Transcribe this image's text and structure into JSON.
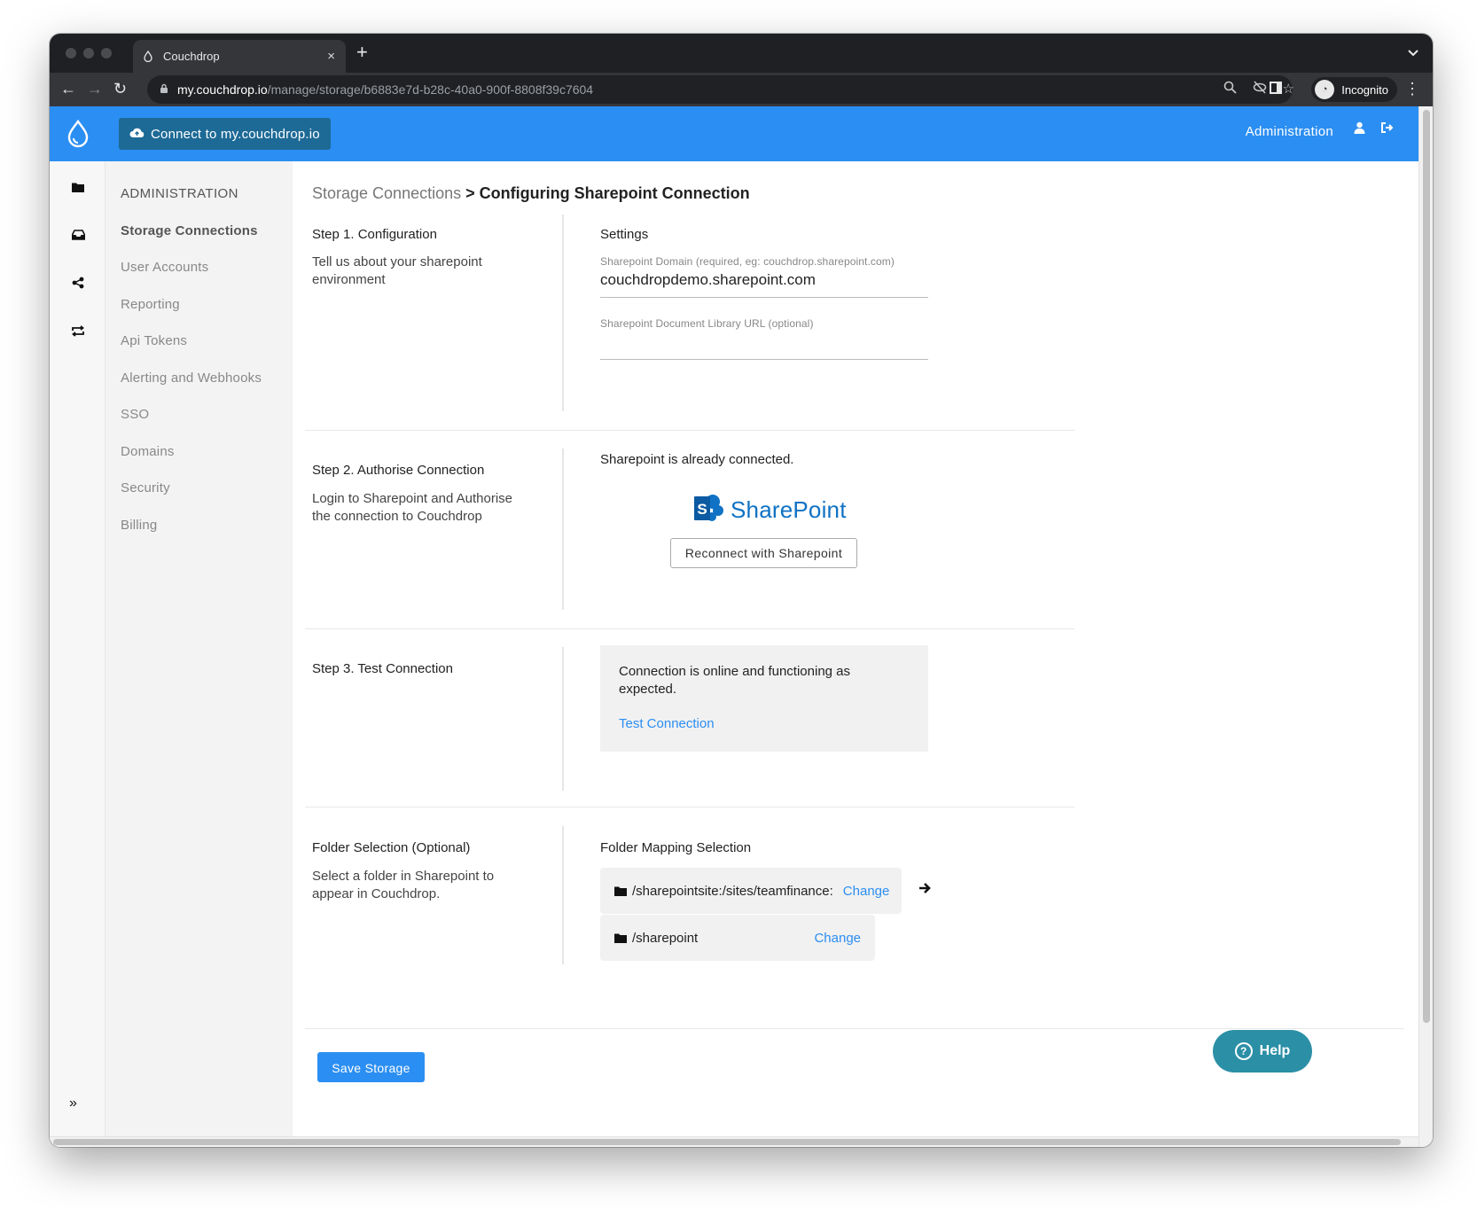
{
  "browser": {
    "tab_title": "Couchdrop",
    "tab_close": "×",
    "new_tab": "+",
    "url_host": "my.couchdrop.io",
    "url_path": "/manage/storage/b6883e7d-b28c-40a0-900f-8808f39c7604",
    "profile_label": "Incognito"
  },
  "header": {
    "connect_button": "Connect to my.couchdrop.io",
    "administration_link": "Administration"
  },
  "sidebar": {
    "heading": "ADMINISTRATION",
    "items": [
      {
        "label": "Storage Connections",
        "active": true
      },
      {
        "label": "User Accounts"
      },
      {
        "label": "Reporting"
      },
      {
        "label": "Api Tokens"
      },
      {
        "label": "Alerting and Webhooks"
      },
      {
        "label": "SSO"
      },
      {
        "label": "Domains"
      },
      {
        "label": "Security"
      },
      {
        "label": "Billing"
      }
    ]
  },
  "breadcrumb": {
    "parent": "Storage Connections",
    "separator": " > ",
    "current": "Configuring Sharepoint Connection"
  },
  "step1": {
    "title": "Step 1. Configuration",
    "description": "Tell us about your sharepoint environment",
    "settings_title": "Settings",
    "domain_label": "Sharepoint Domain (required, eg: couchdrop.sharepoint.com)",
    "domain_value": "couchdropdemo.sharepoint.com",
    "library_label": "Sharepoint Document Library URL (optional)",
    "library_value": ""
  },
  "step2": {
    "title": "Step 2. Authorise Connection",
    "description": "Login to Sharepoint and Authorise the connection to Couchdrop",
    "status": "Sharepoint is already connected.",
    "logo_text": "SharePoint",
    "reconnect_button": "Reconnect with Sharepoint"
  },
  "step3": {
    "title": "Step 3. Test Connection",
    "status_message": "Connection is online and functioning as expected.",
    "test_link": "Test Connection"
  },
  "folder": {
    "title": "Folder Selection (Optional)",
    "description": "Select a folder in Sharepoint to appear in Couchdrop.",
    "mapping_title": "Folder Mapping Selection",
    "source_path": "/sharepointsite:/sites/teamfinance:",
    "target_path": "/sharepoint",
    "change_label": "Change"
  },
  "footer": {
    "save_button": "Save Storage",
    "help_button": "Help"
  },
  "colors": {
    "brand_blue": "#2b8ef2",
    "connect_button_bg": "#1d6a96",
    "help_button_bg": "#2b8fa6",
    "sharepoint_blue": "#0f72c4"
  }
}
